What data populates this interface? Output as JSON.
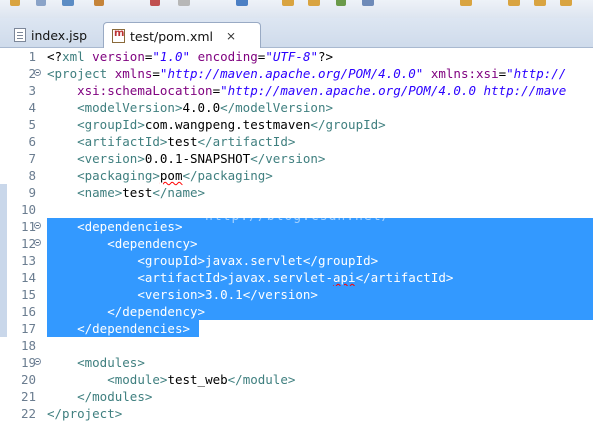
{
  "tabs": [
    {
      "label": "index.jsp",
      "active": false,
      "icon": "jsp-file-icon"
    },
    {
      "label": "test/pom.xml",
      "active": true,
      "icon": "maven-pom-icon"
    }
  ],
  "editor": {
    "selection_color": "#3399ff",
    "watermark": "http://blog.csdn.net/",
    "lines": [
      {
        "num": "1",
        "tokens": [
          [
            "x",
            "<?"
          ],
          [
            "t",
            "xml"
          ],
          [
            "x",
            " "
          ],
          [
            "a",
            "version"
          ],
          [
            "x",
            "="
          ],
          [
            "v",
            "\"1.0\""
          ],
          [
            "x",
            " "
          ],
          [
            "a",
            "encoding"
          ],
          [
            "x",
            "="
          ],
          [
            "v",
            "\"UTF-8\""
          ],
          [
            "x",
            "?>"
          ]
        ]
      },
      {
        "num": "2",
        "fold": true,
        "tokens": [
          [
            "t",
            "<project"
          ],
          [
            "x",
            " "
          ],
          [
            "a",
            "xmlns"
          ],
          [
            "x",
            "="
          ],
          [
            "v",
            "\"http://maven.apache.org/POM/4.0.0\""
          ],
          [
            "x",
            " "
          ],
          [
            "a",
            "xmlns:xsi"
          ],
          [
            "x",
            "="
          ],
          [
            "v",
            "\"http://"
          ]
        ]
      },
      {
        "num": "3",
        "tokens": [
          [
            "x",
            "    "
          ],
          [
            "a",
            "xsi:schemaLocation"
          ],
          [
            "x",
            "="
          ],
          [
            "v",
            "\"http://maven.apache.org/POM/4.0.0 http://mave"
          ]
        ]
      },
      {
        "num": "4",
        "tokens": [
          [
            "x",
            "    "
          ],
          [
            "t",
            "<modelVersion>"
          ],
          [
            "x",
            "4.0.0"
          ],
          [
            "t",
            "</modelVersion>"
          ]
        ]
      },
      {
        "num": "5",
        "tokens": [
          [
            "x",
            "    "
          ],
          [
            "t",
            "<groupId>"
          ],
          [
            "x",
            "com.wangpeng.testmaven"
          ],
          [
            "t",
            "</groupId>"
          ]
        ]
      },
      {
        "num": "6",
        "tokens": [
          [
            "x",
            "    "
          ],
          [
            "t",
            "<artifactId>"
          ],
          [
            "x",
            "test"
          ],
          [
            "t",
            "</artifactId>"
          ]
        ]
      },
      {
        "num": "7",
        "tokens": [
          [
            "x",
            "    "
          ],
          [
            "t",
            "<version>"
          ],
          [
            "x",
            "0.0.1-SNAPSHOT"
          ],
          [
            "t",
            "</version>"
          ]
        ]
      },
      {
        "num": "8",
        "tokens": [
          [
            "x",
            "    "
          ],
          [
            "t",
            "<packaging>"
          ],
          [
            "s",
            "pom"
          ],
          [
            "t",
            "</packaging>"
          ]
        ]
      },
      {
        "num": "9",
        "tokens": [
          [
            "x",
            "    "
          ],
          [
            "t",
            "<name>"
          ],
          [
            "x",
            "test"
          ],
          [
            "t",
            "</name>"
          ]
        ]
      },
      {
        "num": "10",
        "tokens": []
      },
      {
        "num": "11",
        "fold": true,
        "tokens": [
          [
            "x",
            "    "
          ],
          [
            "t",
            "<dependencies>"
          ]
        ]
      },
      {
        "num": "12",
        "fold": true,
        "tokens": [
          [
            "x",
            "        "
          ],
          [
            "t",
            "<dependency>"
          ]
        ]
      },
      {
        "num": "13",
        "tokens": [
          [
            "x",
            "            "
          ],
          [
            "t",
            "<groupId>"
          ],
          [
            "x",
            "javax.servlet"
          ],
          [
            "t",
            "</groupId>"
          ]
        ]
      },
      {
        "num": "14",
        "tokens": [
          [
            "x",
            "            "
          ],
          [
            "t",
            "<artifactId>"
          ],
          [
            "x",
            "javax.servlet-"
          ],
          [
            "s",
            "api"
          ],
          [
            "t",
            "</artifactId>"
          ]
        ]
      },
      {
        "num": "15",
        "tokens": [
          [
            "x",
            "            "
          ],
          [
            "t",
            "<version>"
          ],
          [
            "x",
            "3.0.1"
          ],
          [
            "t",
            "</version>"
          ]
        ]
      },
      {
        "num": "16",
        "tokens": [
          [
            "x",
            "        "
          ],
          [
            "t",
            "</dependency>"
          ]
        ]
      },
      {
        "num": "17",
        "tokens": [
          [
            "x",
            "    "
          ],
          [
            "t",
            "</dependencies>"
          ]
        ]
      },
      {
        "num": "18",
        "tokens": []
      },
      {
        "num": "19",
        "fold": true,
        "tokens": [
          [
            "x",
            "    "
          ],
          [
            "t",
            "<modules>"
          ]
        ]
      },
      {
        "num": "20",
        "tokens": [
          [
            "x",
            "        "
          ],
          [
            "t",
            "<module>"
          ],
          [
            "x",
            "test_web"
          ],
          [
            "t",
            "</module>"
          ]
        ]
      },
      {
        "num": "21",
        "tokens": [
          [
            "x",
            "    "
          ],
          [
            "t",
            "</modules>"
          ]
        ]
      },
      {
        "num": "22",
        "tokens": [
          [
            "t",
            "</project>"
          ]
        ]
      }
    ]
  }
}
